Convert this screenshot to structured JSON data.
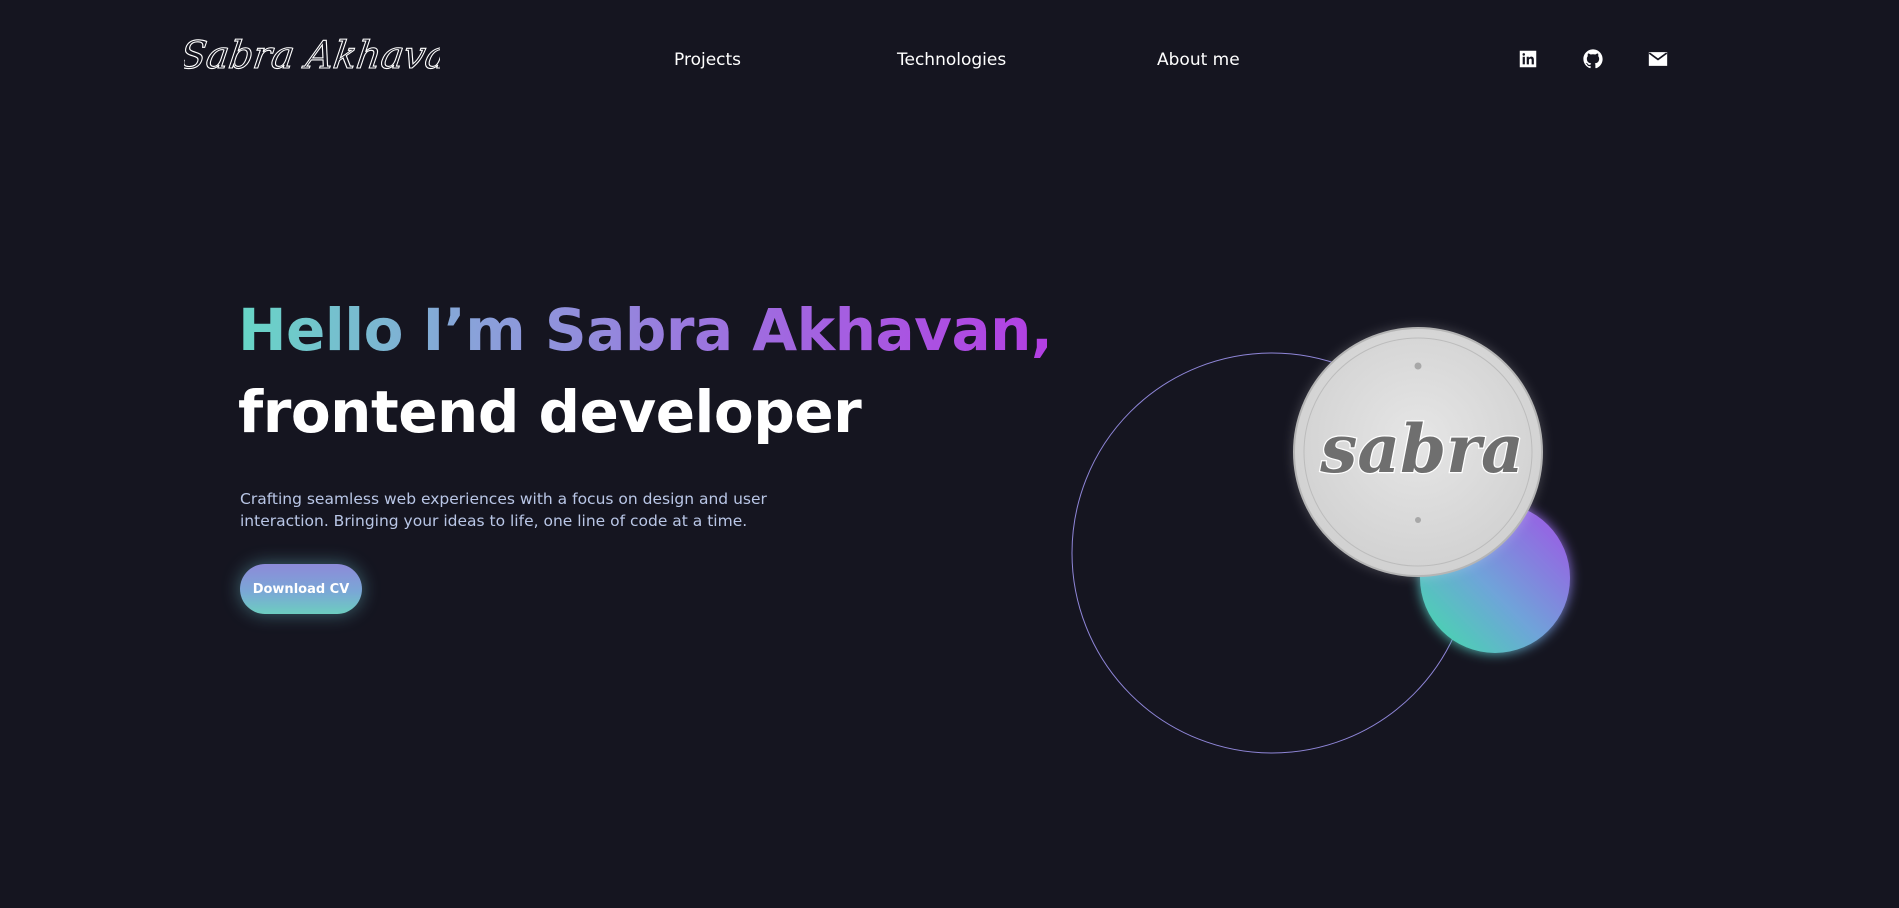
{
  "header": {
    "logo_text": "Sabra Akhavan",
    "nav": [
      {
        "label": "Projects"
      },
      {
        "label": "Technologies"
      },
      {
        "label": "About me"
      }
    ],
    "social_icons": [
      "linkedin-icon",
      "github-icon",
      "mail-icon"
    ]
  },
  "hero": {
    "greeting": "Hello I’m Sabra Akhavan,",
    "role": "frontend developer",
    "description": "Crafting seamless web experiences with a focus on design and user interaction. Bringing your ideas to life, one line of code at a time.",
    "cta_label": "Download CV"
  },
  "badge": {
    "text": "sabra"
  },
  "colors": {
    "background": "#151520",
    "gradient_start": "#67d6c6",
    "gradient_end": "#b33ee3",
    "outline_circle": "#8f86d8",
    "badge_fill": "#d9d9d9",
    "badge_text": "#6f6f6f"
  }
}
